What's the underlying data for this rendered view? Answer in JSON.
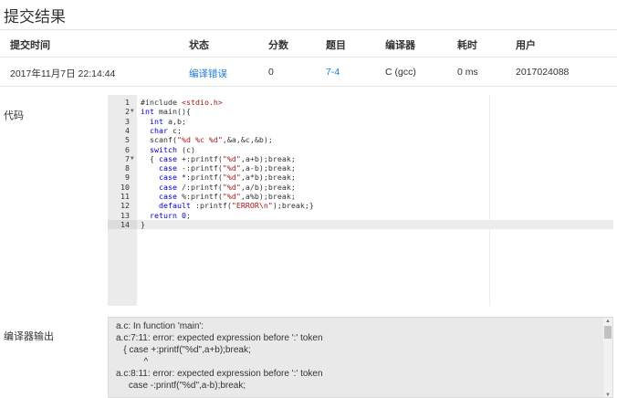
{
  "page": {
    "title": "提交结果"
  },
  "table": {
    "headers": [
      "提交时间",
      "状态",
      "分数",
      "题目",
      "编译器",
      "耗时",
      "用户"
    ],
    "row": {
      "time": "2017年11月7日 22:14:44",
      "status": "编译错误",
      "score": "0",
      "problem": "7-4",
      "compiler": "C (gcc)",
      "elapsed": "0 ms",
      "user": "2017024088"
    }
  },
  "code_label": "代码",
  "output_label": "编译器输出",
  "code_lines": [
    "#include <stdio.h>",
    "int main(){",
    "  int a,b;",
    "  char c;",
    "  scanf(\"%d %c %d\",&a,&c,&b);",
    "  switch (c)",
    "  { case +:printf(\"%d\",a+b);break;",
    "    case -:printf(\"%d\",a-b);break;",
    "    case *:printf(\"%d\",a*b);break;",
    "    case /:printf(\"%d\",a/b);break;",
    "    case %:printf(\"%d\",a%b);break;",
    "    default :printf(\"ERROR\\n\");break;}",
    "  return 0;",
    "}"
  ],
  "fold_lines": [
    2,
    7
  ],
  "active_line": 14,
  "output_lines": [
    "a.c: In function 'main':",
    "a.c:7:11: error: expected expression before ':' token",
    "   { case +:printf(\"%d\",a+b);break;",
    "           ^",
    "a.c:8:11: error: expected expression before ':' token",
    "     case -:printf(\"%d\",a-b);break;"
  ],
  "colors": {
    "link": "#1a7bd8",
    "keyword": "#0000cc",
    "string": "#a31515"
  },
  "icons": {
    "fold": "fold-arrow-icon",
    "scroll_up": "scroll-up-icon",
    "scroll_down": "scroll-down-icon"
  }
}
